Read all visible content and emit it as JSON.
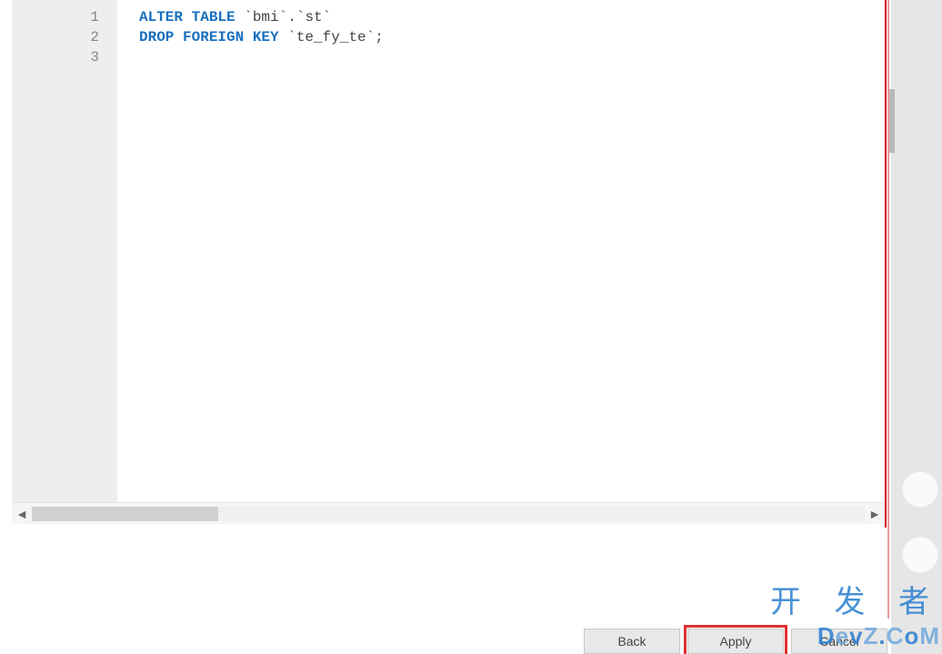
{
  "editor": {
    "gutter": [
      "1",
      "2",
      "3"
    ],
    "lines": [
      {
        "tokens": [
          {
            "cls": "keyword",
            "t": "ALTER TABLE"
          },
          {
            "cls": "punct",
            "t": " `"
          },
          {
            "cls": "identifier",
            "t": "bmi"
          },
          {
            "cls": "punct",
            "t": "`.`"
          },
          {
            "cls": "identifier",
            "t": "st"
          },
          {
            "cls": "punct",
            "t": "`"
          }
        ]
      },
      {
        "tokens": [
          {
            "cls": "keyword",
            "t": "DROP FOREIGN KEY"
          },
          {
            "cls": "punct",
            "t": " `"
          },
          {
            "cls": "identifier",
            "t": "te_fy_te"
          },
          {
            "cls": "punct",
            "t": "`;"
          }
        ]
      },
      {
        "tokens": []
      }
    ]
  },
  "scroll": {
    "left_arrow": "◄",
    "right_arrow": "►"
  },
  "buttons": {
    "back": "Back",
    "apply": "Apply",
    "cancel": "Cancel"
  },
  "watermark": {
    "cn": "开 发 者",
    "en_parts": [
      "D",
      "e",
      "v",
      "Z",
      ".",
      "C",
      "o",
      "M"
    ]
  }
}
